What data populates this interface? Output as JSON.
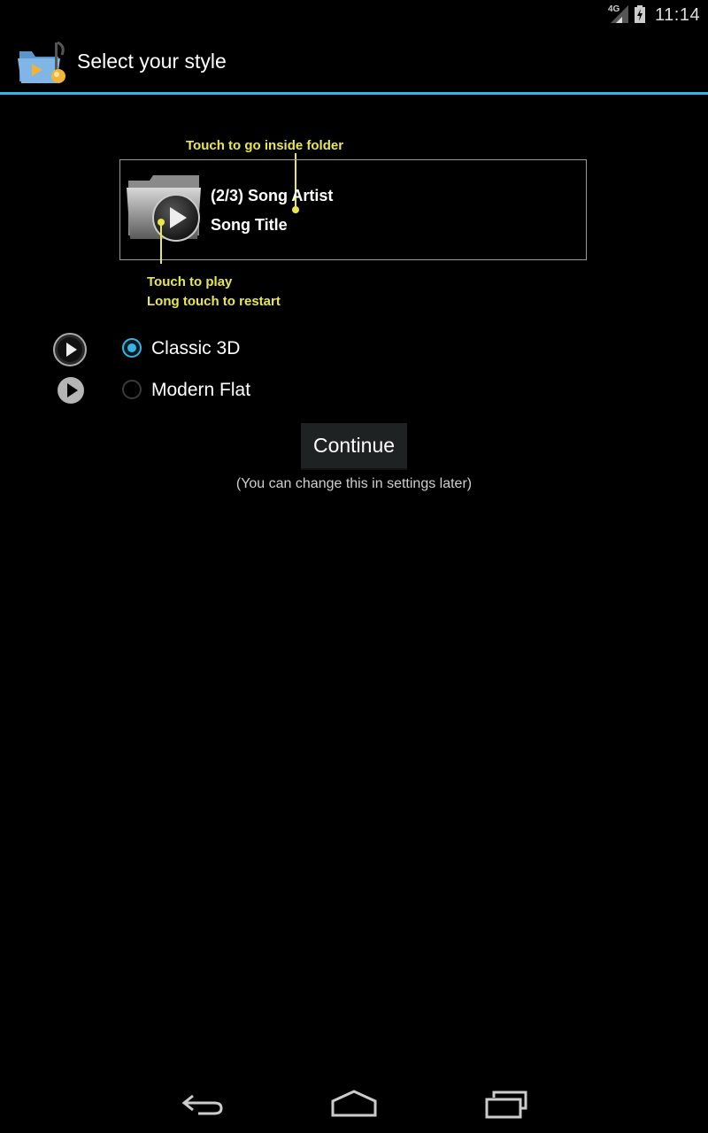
{
  "status_bar": {
    "network": "4G",
    "time": "11:14"
  },
  "action_bar": {
    "title": "Select your style",
    "app_icon": "folder-music-icon",
    "divider_color": "#33b5e5"
  },
  "preview": {
    "hint_folder": "Touch to go inside folder",
    "artist_line": "(2/3) Song Artist",
    "title_line": "Song Title",
    "hint_play": "Touch to play",
    "hint_restart": "Long touch to restart",
    "hint_color": "#e8e84a"
  },
  "styles": [
    {
      "label": "Classic 3D",
      "selected": true,
      "icon": "play-circle-3d-icon"
    },
    {
      "label": "Modern Flat",
      "selected": false,
      "icon": "play-circle-flat-icon"
    }
  ],
  "continue_label": "Continue",
  "note": "(You can change this in settings later)",
  "nav": {
    "back": "back-icon",
    "home": "home-icon",
    "recents": "recents-icon"
  }
}
